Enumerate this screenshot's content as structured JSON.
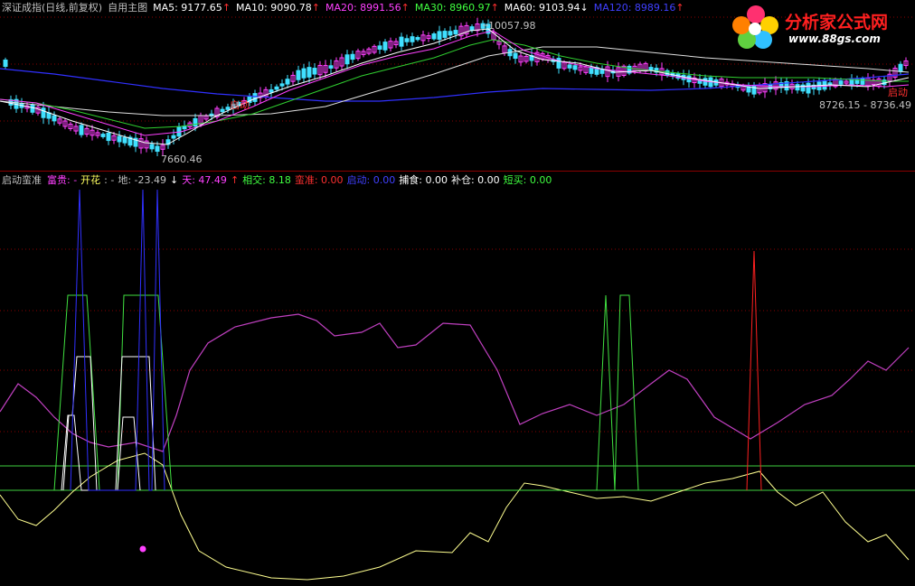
{
  "top_header": {
    "title": "深证成指(日线,前复权)",
    "subtitle": "自用主图",
    "ma": [
      {
        "label": "MA5: 9177.65",
        "arrow": "↑",
        "color": "#ffffff"
      },
      {
        "label": "MA10: 9090.78",
        "arrow": "↑",
        "color": "#ffffff"
      },
      {
        "label": "MA20: 8991.56",
        "arrow": "↑",
        "color": "#ff40ff"
      },
      {
        "label": "MA30: 8960.97",
        "arrow": "↑",
        "color": "#40ff40"
      },
      {
        "label": "MA60: 9103.94",
        "arrow": "↓",
        "color": "#ffffff"
      },
      {
        "label": "MA120: 8989.16",
        "arrow": "↑",
        "color": "#4040ff"
      }
    ]
  },
  "price_labels": {
    "high": "10057.98",
    "low": "7660.46",
    "range": "8726.15 - 8736.49",
    "signal_left": "启动",
    "signal_right": "启动"
  },
  "bottom_header": {
    "name": "启动蛮准",
    "items": [
      {
        "label": "富贵: -",
        "color": "#ff40ff"
      },
      {
        "label": "开花",
        "color": "#ffff60"
      },
      {
        "label": ": -",
        "color": "#c0c0c0"
      },
      {
        "label": "地: -23.49",
        "color": "#c0c0c0"
      },
      {
        "label": "↓",
        "color": "#ffffff"
      },
      {
        "label": "天: 47.49",
        "color": "#ff40ff"
      },
      {
        "label": "↑",
        "color": "#ff3030"
      },
      {
        "label": "相交: 8.18",
        "color": "#40ff40"
      },
      {
        "label": "蛮准: 0.00",
        "color": "#ff3030"
      },
      {
        "label": "启动: 0.00",
        "color": "#4040ff"
      },
      {
        "label": "捕食: 0.00",
        "color": "#ffffff"
      },
      {
        "label": "补仓: 0.00",
        "color": "#ffffff"
      },
      {
        "label": "短买: 0.00",
        "color": "#40ff40"
      }
    ]
  },
  "logo": {
    "title": "分析家公式网",
    "url": "www.88gs.com"
  },
  "colors": {
    "up": "#ff40ff",
    "down": "#40e0ff",
    "grid": "#8a0000"
  }
}
